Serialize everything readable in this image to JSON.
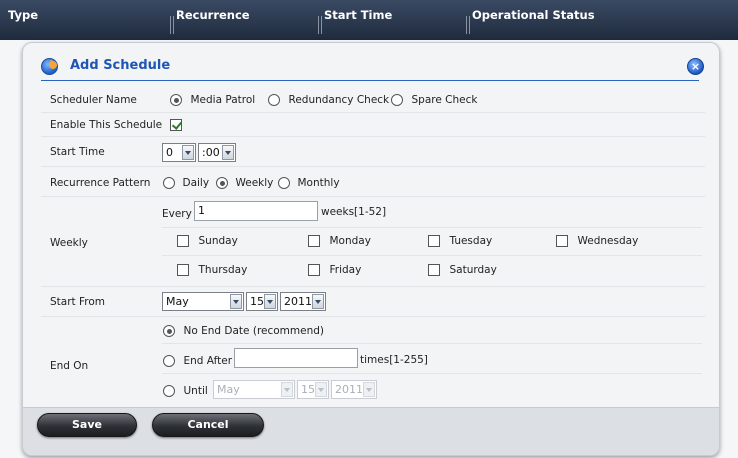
{
  "table_header": {
    "columns": [
      "Type",
      "Recurrence",
      "Start Time",
      "Operational Status"
    ]
  },
  "dialog": {
    "title": "Add Schedule",
    "title_icon": "schedule-globe-icon",
    "close_icon": "close-icon",
    "scheduler_name": {
      "label": "Scheduler Name",
      "options": [
        "Media Patrol",
        "Redundancy Check",
        "Spare Check"
      ],
      "selected": "Media Patrol"
    },
    "enable": {
      "label": "Enable This Schedule",
      "checked": true
    },
    "start_time": {
      "label": "Start Time",
      "hour": "0",
      "minute": ":00"
    },
    "recurrence": {
      "label": "Recurrence Pattern",
      "options": [
        "Daily",
        "Weekly",
        "Monthly"
      ],
      "selected": "Weekly"
    },
    "weekly": {
      "label": "Weekly",
      "every_label": "Every",
      "every_value": "1",
      "weeks_hint": "weeks[1-52]",
      "days": [
        "Sunday",
        "Monday",
        "Tuesday",
        "Wednesday",
        "Thursday",
        "Friday",
        "Saturday"
      ]
    },
    "start_from": {
      "label": "Start From",
      "month": "May",
      "day": "15",
      "year": "2011"
    },
    "end_on": {
      "label": "End On",
      "no_end": "No End Date (recommend)",
      "end_after": "End After",
      "end_after_value": "",
      "times_hint": "times[1-255]",
      "until": "Until",
      "until_month": "May",
      "until_day": "15",
      "until_year": "2011",
      "selected": "No End Date (recommend)"
    },
    "buttons": {
      "save": "Save",
      "cancel": "Cancel"
    }
  }
}
